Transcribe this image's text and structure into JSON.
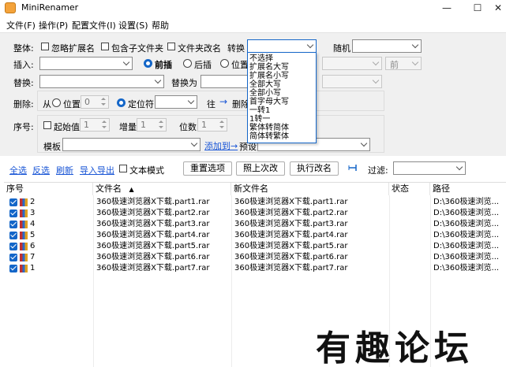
{
  "window": {
    "title": "MiniRenamer",
    "minimize": "—",
    "maximize": "☐",
    "close": "✕"
  },
  "menu": [
    "文件(F)",
    "操作(P)",
    "配置文件(I)",
    "设置(S)",
    "帮助"
  ],
  "overall": {
    "label": "整体:",
    "ignore_ext": "忽略扩展名",
    "include_subfolder": "包含子文件夹",
    "folder_rename": "文件夹改名",
    "convert_label": "转换",
    "random_label": "随机"
  },
  "insert": {
    "label": "插入:",
    "front": "前插",
    "back": "后插",
    "position": "位置"
  },
  "replace": {
    "label": "替换:",
    "replace_with": "替换为"
  },
  "delete": {
    "label": "删除:",
    "from": "从",
    "position": "位置",
    "position_value": "0",
    "locator": "定位符",
    "to": "往",
    "arrow": "→",
    "delete_btn": "删除"
  },
  "sequence": {
    "label": "序号:",
    "start_label": "起始值",
    "start_value": "1",
    "step_label": "增量",
    "step_value": "1",
    "digits_label": "位数",
    "digits_value": "1"
  },
  "template": {
    "label": "模板",
    "add_link": "添加到→",
    "preset_label": "预设"
  },
  "convert_menu": [
    "不选择",
    "扩展名大写",
    "扩展名小写",
    "全部大写",
    "全部小写",
    "首字母大写",
    "一转1",
    "1转一",
    "繁体转简体",
    "简体转繁体"
  ],
  "toolbar": {
    "select_all": "全选",
    "invert": "反选",
    "refresh": "刷新",
    "import_export": "导入导出",
    "text_mode": "文本模式",
    "reset_btn": "重置选项",
    "last_btn": "照上次改",
    "rename_btn": "执行改名",
    "filter_label": "过滤:"
  },
  "grid": {
    "headers": [
      "序号",
      "文件名",
      "新文件名",
      "状态",
      "路径"
    ],
    "sort_indicator": "▲",
    "rows": [
      {
        "seq": "2",
        "name": "360极速浏览器X下载.part1.rar",
        "new": "360极速浏览器X下载.part1.rar",
        "status": "",
        "path": "D:\\360极速浏览..."
      },
      {
        "seq": "3",
        "name": "360极速浏览器X下载.part2.rar",
        "new": "360极速浏览器X下载.part2.rar",
        "status": "",
        "path": "D:\\360极速浏览..."
      },
      {
        "seq": "4",
        "name": "360极速浏览器X下载.part3.rar",
        "new": "360极速浏览器X下载.part3.rar",
        "status": "",
        "path": "D:\\360极速浏览..."
      },
      {
        "seq": "5",
        "name": "360极速浏览器X下载.part4.rar",
        "new": "360极速浏览器X下载.part4.rar",
        "status": "",
        "path": "D:\\360极速浏览..."
      },
      {
        "seq": "6",
        "name": "360极速浏览器X下载.part5.rar",
        "new": "360极速浏览器X下载.part5.rar",
        "status": "",
        "path": "D:\\360极速浏览..."
      },
      {
        "seq": "7",
        "name": "360极速浏览器X下载.part6.rar",
        "new": "360极速浏览器X下载.part6.rar",
        "status": "",
        "path": "D:\\360极速浏览..."
      },
      {
        "seq": "1",
        "name": "360极速浏览器X下载.part7.rar",
        "new": "360极速浏览器X下载.part7.rar",
        "status": "",
        "path": "D:\\360极速浏览..."
      }
    ]
  },
  "misc": {
    "ext_dropdown_value": "前",
    "watermark": "有趣论坛"
  },
  "colors": {
    "accent": "#1466c8",
    "link": "#1a56d6",
    "panel_bg": "#f0f0f0"
  }
}
